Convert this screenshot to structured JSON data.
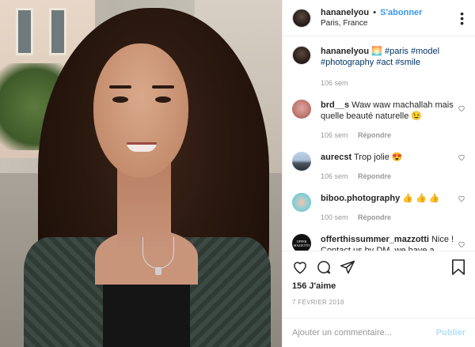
{
  "header": {
    "username": "hananelyou",
    "separator": "•",
    "follow_label": "S'abonner",
    "location": "Paris, France"
  },
  "caption": {
    "username": "hananelyou",
    "emoji": "🌅",
    "hashtags": [
      "#paris",
      "#model",
      "#photography",
      "#act",
      "#smile"
    ],
    "age": "106 sem"
  },
  "comments": [
    {
      "username": "brd__s",
      "text": "Waw waw machallah mais quelle beauté naturelle 😉",
      "age": "106 sem",
      "reply_label": "Répondre"
    },
    {
      "username": "aurecst",
      "text": "Trop jolie 😍",
      "age": "106 sem",
      "reply_label": "Répondre"
    },
    {
      "username": "biboo.photography",
      "text": "👍 👍 👍",
      "age": "100 sem",
      "reply_label": "Répondre"
    },
    {
      "username": "offerthissummer_mazzotti",
      "text": "Nice ! Contact us by DM, we have a",
      "avatar_text": "OFFER MAZZOTTI"
    }
  ],
  "actions": {
    "icons": [
      "heart-icon",
      "comment-icon",
      "share-icon",
      "bookmark-icon"
    ],
    "likes": "156 J'aime",
    "date": "7 FÉVRIER 2018"
  },
  "add_comment": {
    "placeholder": "Ajouter un commentaire...",
    "publish_label": "Publier"
  },
  "colors": {
    "link": "#3897f0",
    "hashtag": "#003569",
    "muted": "#999999",
    "publish_disabled": "#b2dffc"
  }
}
